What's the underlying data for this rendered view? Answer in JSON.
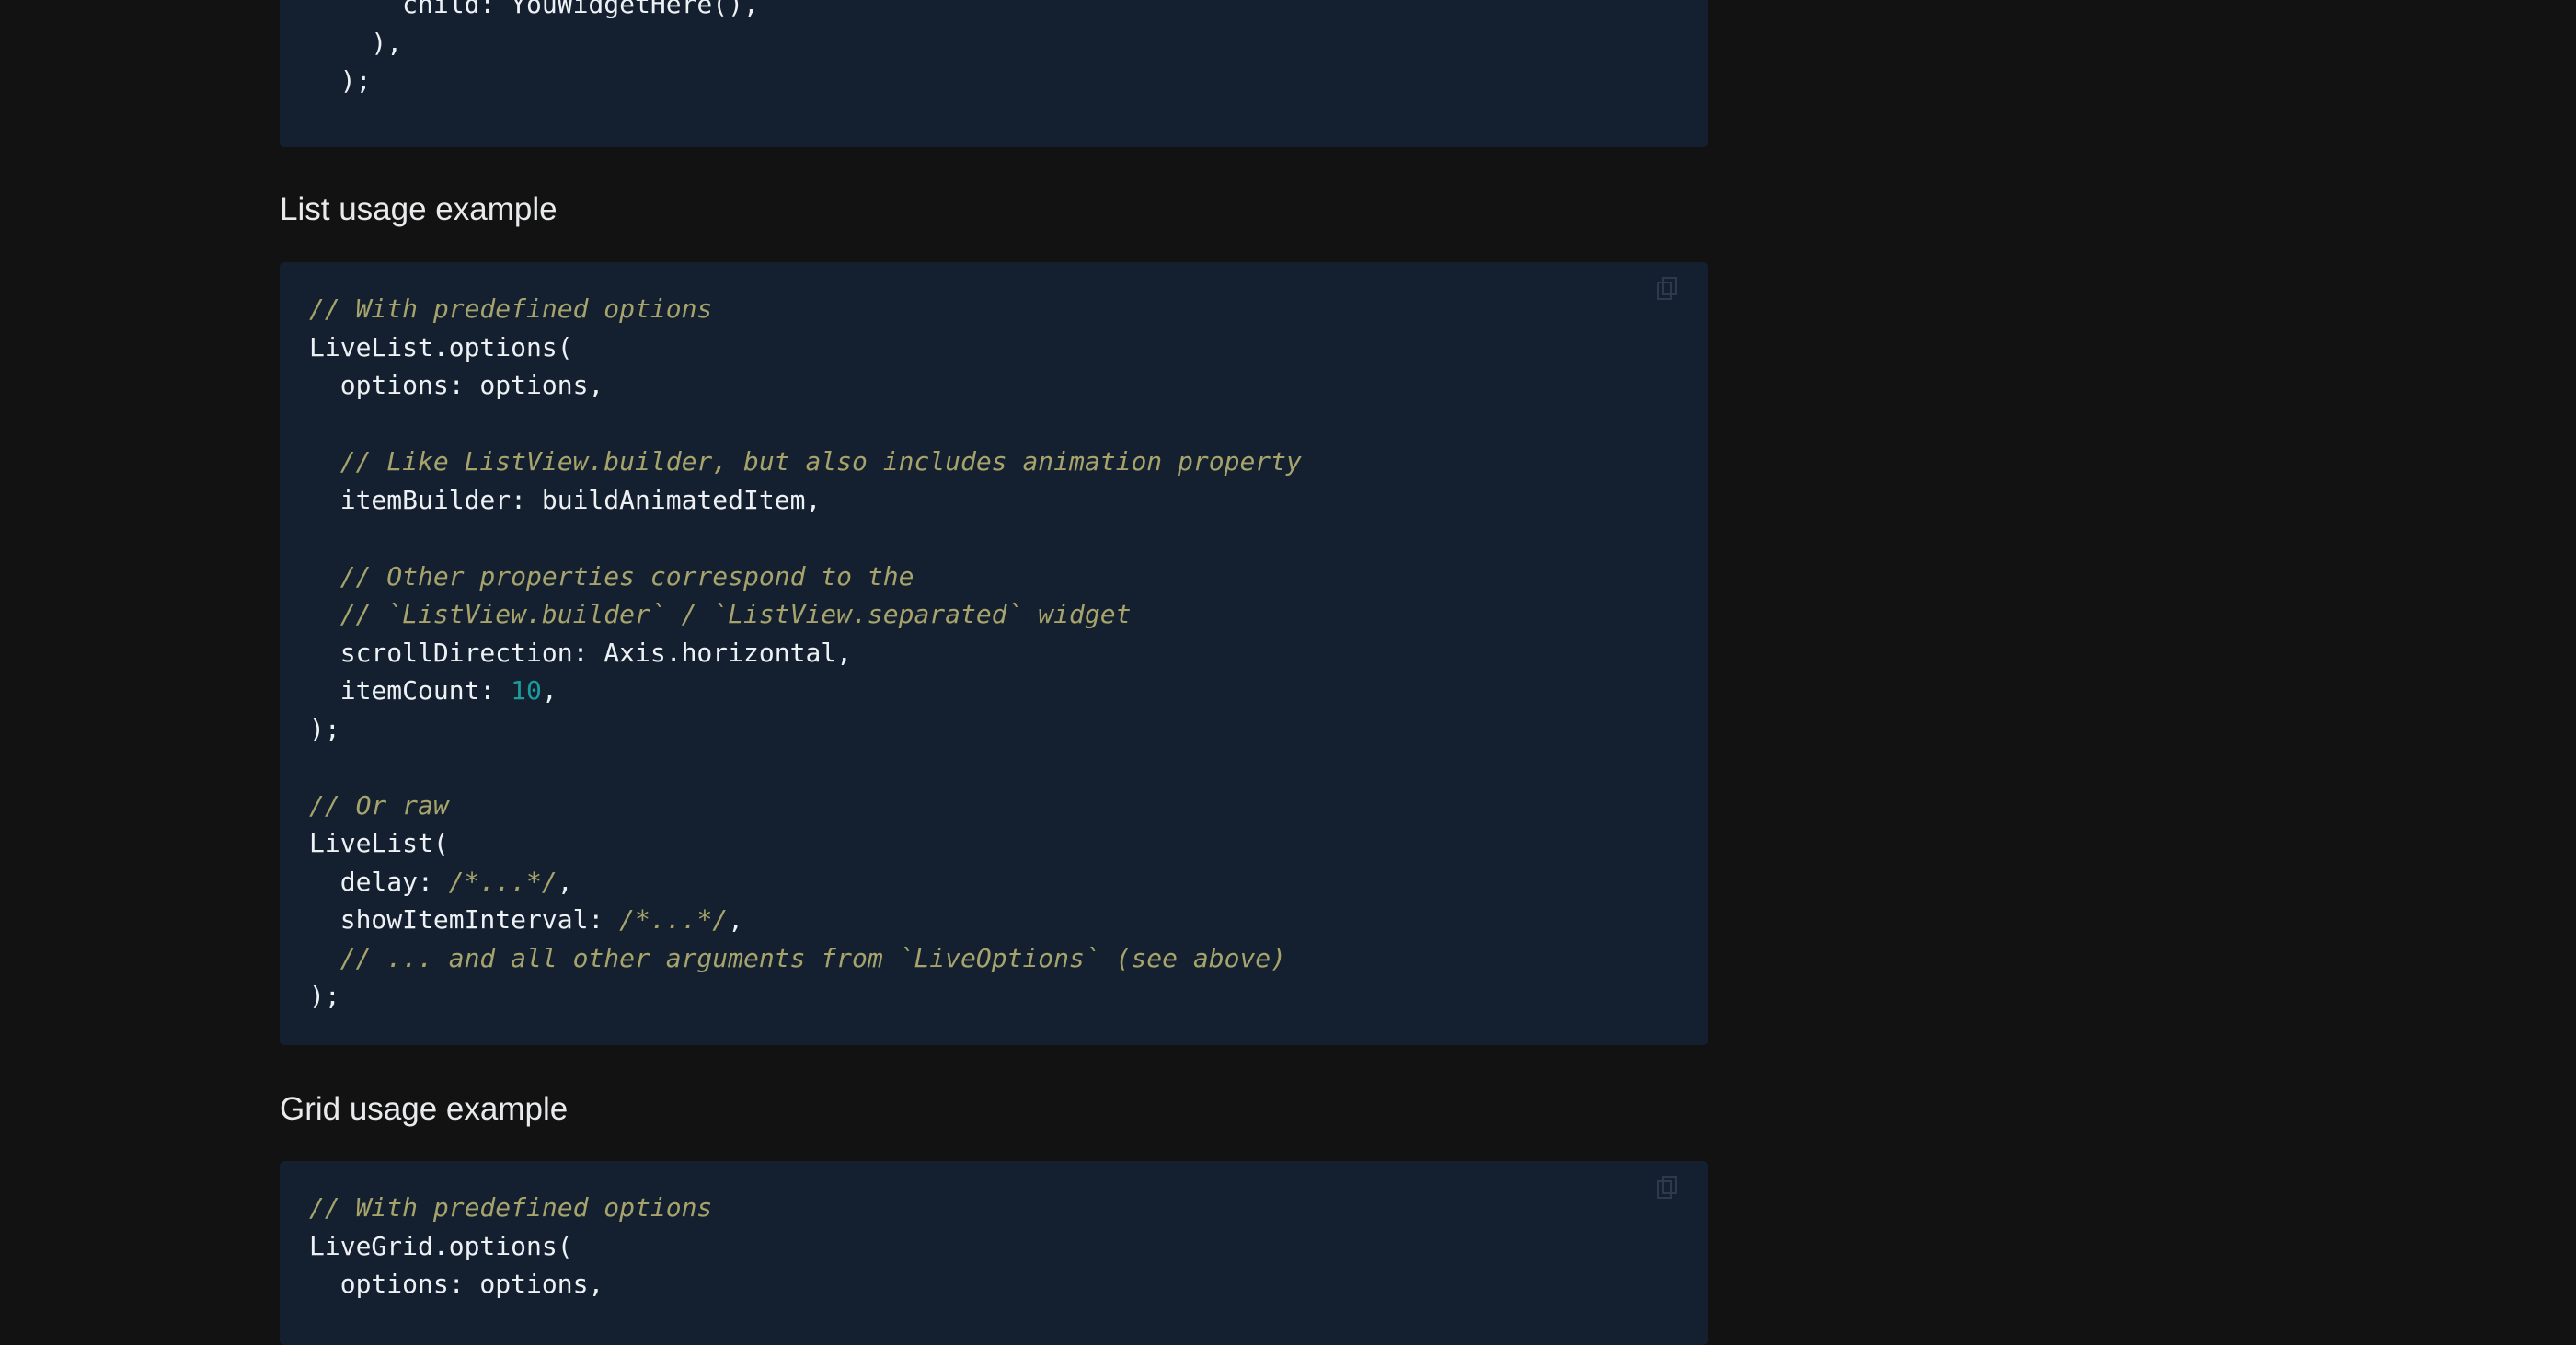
{
  "top_block": {
    "lines": [
      "      child: YouWidgetHere(),",
      "    ),",
      "  );"
    ]
  },
  "list_section": {
    "heading": "List usage example",
    "lines": [
      "// With predefined options",
      "LiveList.options(",
      "  options: options,",
      "",
      "  // Like ListView.builder, but also includes animation property",
      "  itemBuilder: buildAnimatedItem,",
      "",
      "  // Other properties correspond to the",
      "  // `ListView.builder` / `ListView.separated` widget",
      "  scrollDirection: Axis.horizontal,",
      "  itemCount: ",
      "10",
      ",",
      ");",
      "",
      "// Or raw",
      "LiveList(",
      "  delay: ",
      "/*...*/",
      ",",
      "  showItemInterval: ",
      "/*...*/",
      ",",
      "  // ... and all other arguments from `LiveOptions` (see above)",
      ");"
    ]
  },
  "grid_section": {
    "heading": "Grid usage example",
    "lines": [
      "// With predefined options",
      "LiveGrid.options(",
      "  options: options,"
    ]
  },
  "icons": {
    "copy": "copy-icon"
  },
  "colors": {
    "background": "#121212",
    "code_background": "#142030",
    "code_text": "#eef1f4",
    "comment": "#a6a36b",
    "number": "#1b9c9c",
    "heading": "#e9eaec"
  }
}
